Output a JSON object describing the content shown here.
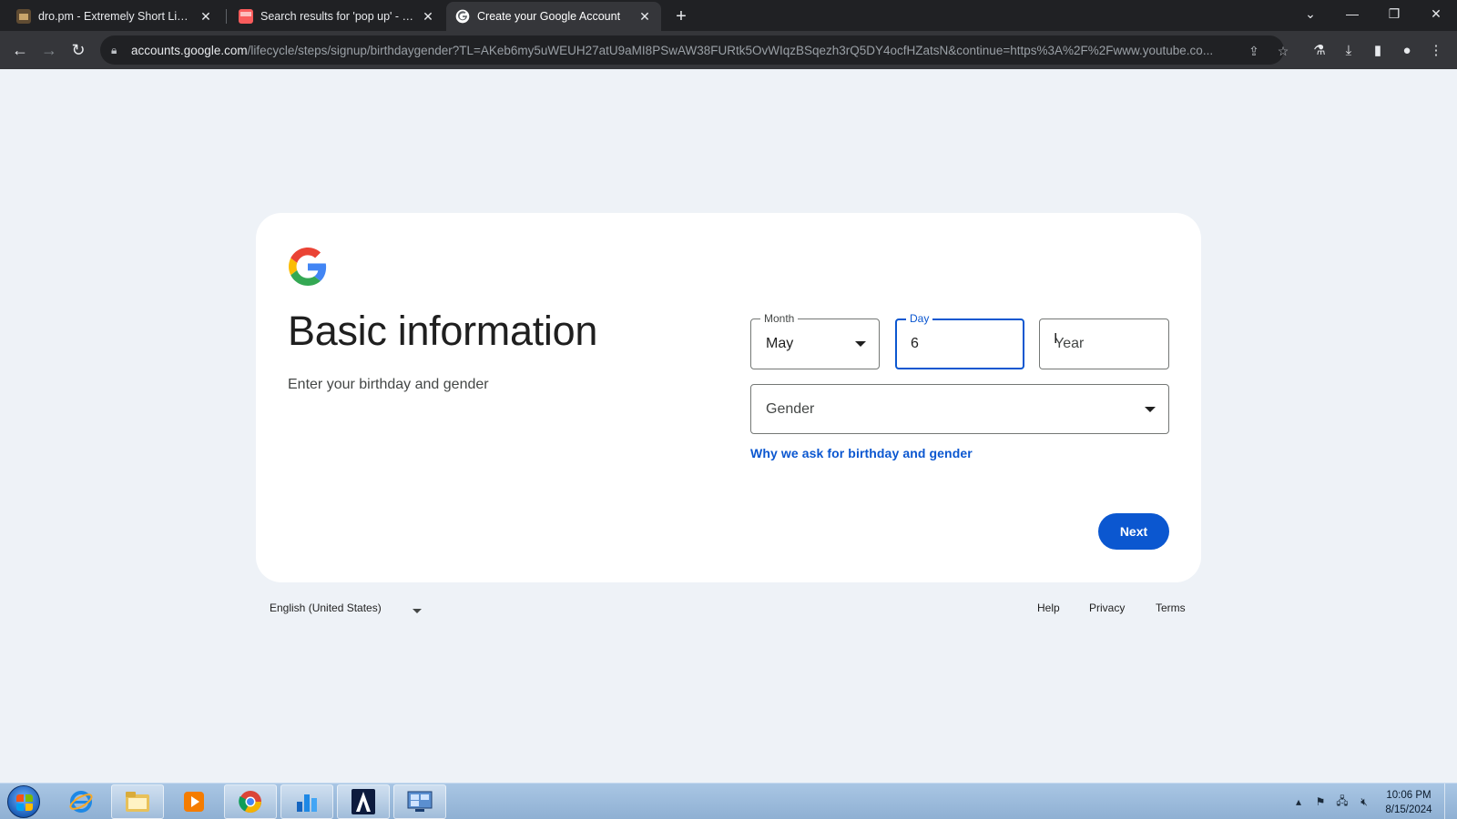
{
  "browser": {
    "tabs": [
      {
        "title": "dro.pm - Extremely Short Links",
        "active": false
      },
      {
        "title": "Search results for 'pop up' - itch.io",
        "active": false
      },
      {
        "title": "Create your Google Account",
        "active": true
      }
    ],
    "url_host": "accounts.google.com",
    "url_path": "/lifecycle/steps/signup/birthdaygender?TL=AKeb6my5uWEUH27atU9aMI8PSwAW38FURtk5OvWIqzBSqezh3rQ5DY4ocfHZatsN&continue=https%3A%2F%2Fwww.youtube.co..."
  },
  "page": {
    "heading": "Basic information",
    "subtext": "Enter your birthday and gender",
    "month": {
      "label": "Month",
      "value": "May"
    },
    "day": {
      "label": "Day",
      "value": "6"
    },
    "year": {
      "placeholder": "Year"
    },
    "gender": {
      "placeholder": "Gender"
    },
    "why_link": "Why we ask for birthday and gender",
    "next_label": "Next"
  },
  "footer": {
    "language": "English (United States)",
    "links": [
      "Help",
      "Privacy",
      "Terms"
    ]
  },
  "taskbar": {
    "time": "10:06 PM",
    "date": "8/15/2024"
  },
  "colors": {
    "accent": "#0b57d0",
    "page_bg": "#eef2f7"
  }
}
